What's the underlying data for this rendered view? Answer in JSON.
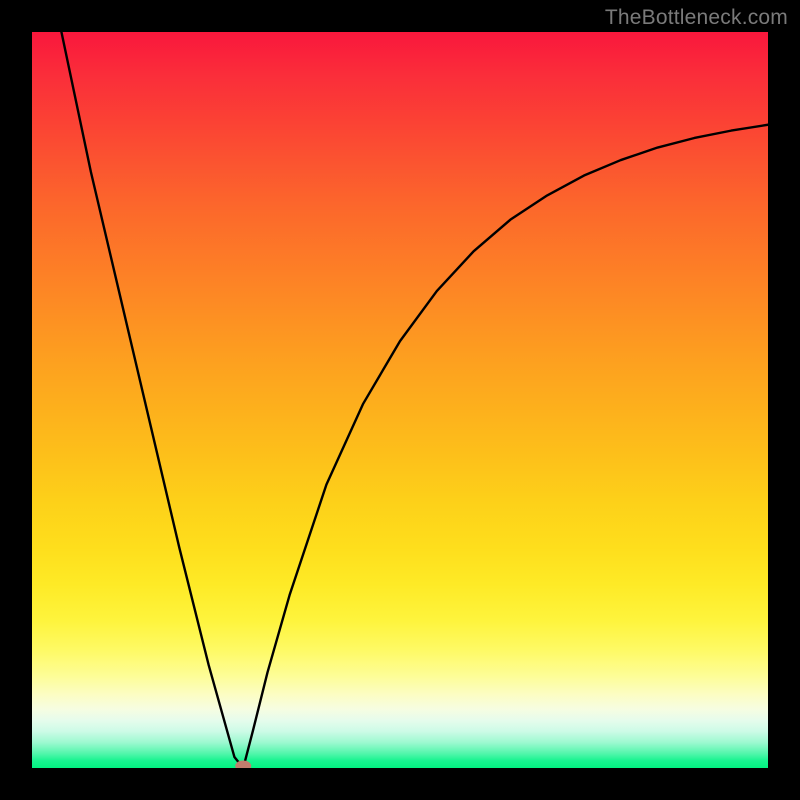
{
  "watermark": "TheBottleneck.com",
  "chart_data": {
    "type": "line",
    "title": "",
    "xlabel": "",
    "ylabel": "",
    "xlim": [
      0,
      1
    ],
    "ylim": [
      0,
      1
    ],
    "grid": false,
    "legend": false,
    "min_point": {
      "x": 0.287,
      "y": 0.0
    },
    "series": [
      {
        "name": "left-branch",
        "x": [
          0.04,
          0.08,
          0.12,
          0.16,
          0.2,
          0.24,
          0.275,
          0.287
        ],
        "y": [
          1.0,
          0.81,
          0.64,
          0.47,
          0.3,
          0.14,
          0.015,
          0.0
        ]
      },
      {
        "name": "right-branch",
        "x": [
          0.287,
          0.3,
          0.32,
          0.35,
          0.4,
          0.45,
          0.5,
          0.55,
          0.6,
          0.65,
          0.7,
          0.75,
          0.8,
          0.85,
          0.9,
          0.95,
          1.0
        ],
        "y": [
          0.0,
          0.05,
          0.13,
          0.235,
          0.385,
          0.495,
          0.58,
          0.648,
          0.702,
          0.745,
          0.778,
          0.805,
          0.826,
          0.843,
          0.856,
          0.866,
          0.874
        ]
      }
    ],
    "colors": {
      "background_top": "#f9173c",
      "background_bottom": "#02f281",
      "curve": "#000000",
      "min_point": "#c17d6d"
    }
  }
}
